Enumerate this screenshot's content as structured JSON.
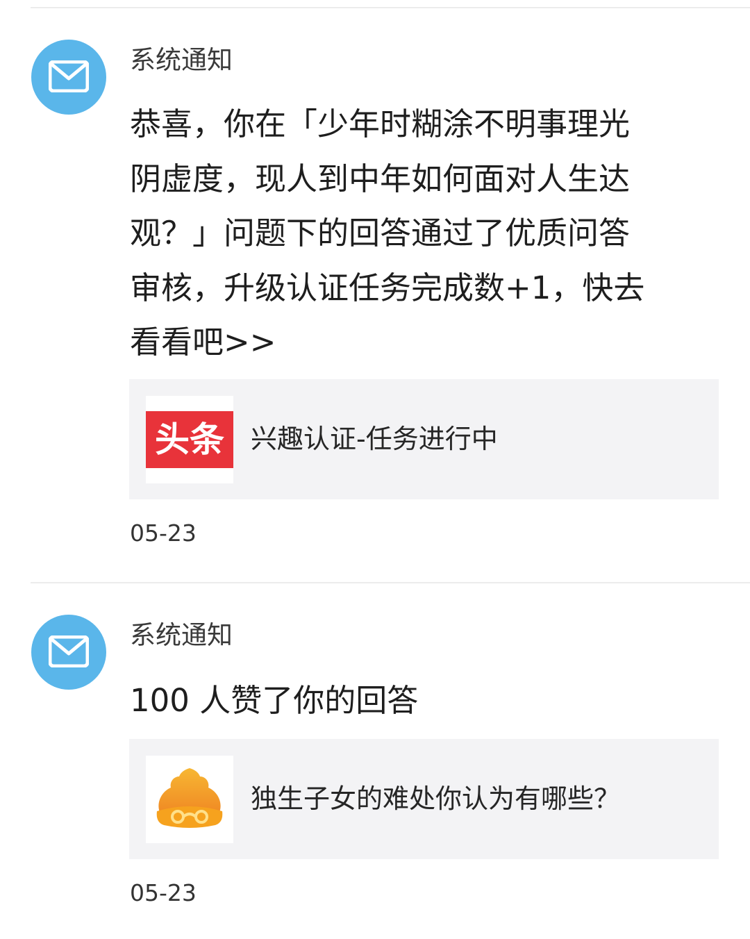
{
  "notifications": [
    {
      "sender": "系统通知",
      "avatar_icon": "mail-icon",
      "message_lines": [
        "恭喜，你在「少年时糊涂不明事理光",
        "阴虚度，现人到中年如何面对人生达",
        "观？」问题下的回答通过了优质问答",
        "审核，升级认证任务完成数+1，快去",
        "看看吧>>"
      ],
      "card": {
        "thumb_icon": "toutiao-logo",
        "thumb_text": "头条",
        "title": "兴趣认证-任务进行中"
      },
      "date": "05-23"
    },
    {
      "sender": "系统通知",
      "avatar_icon": "mail-icon",
      "message": "100 人赞了你的回答",
      "card": {
        "thumb_icon": "wukong-logo",
        "title": "独生子女的难处你认为有哪些？"
      },
      "date": "05-23"
    }
  ],
  "colors": {
    "avatar": "#5ab6ea",
    "card_bg": "#f3f3f5",
    "toutiao_red": "#e8333a",
    "wukong_orange": "#f5a623"
  }
}
